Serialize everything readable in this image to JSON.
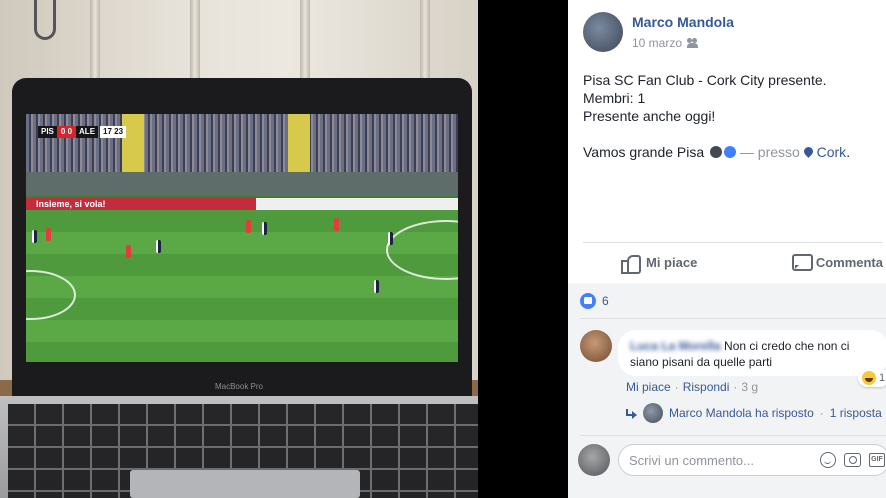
{
  "photo": {
    "laptop_brand": "MacBook Pro",
    "scoreboard": {
      "home": "PIS",
      "score": "0 0",
      "away": "ALE",
      "clock": "17 23"
    },
    "banner_text": "Insieme, si vola!"
  },
  "post": {
    "author": "Marco Mandola",
    "date": "10 marzo",
    "audience_icon": "friends-icon",
    "line1": "Pisa SC Fan Club - Cork City presente.",
    "line2": "Membri: 1",
    "line3": "Presente anche oggi!",
    "line4_text": "Vamos grande Pisa",
    "line4_presso": "— presso",
    "location": "Cork",
    "period": "."
  },
  "actions": {
    "like_label": "Mi piace",
    "comment_label": "Commenta"
  },
  "reactions": {
    "count": "6",
    "icon": "like-icon"
  },
  "comment": {
    "author": "Luca La Morella",
    "text": "Non ci credo che non ci siano pisani da quelle parti",
    "reaction_count": "1",
    "reaction_icon": "haha-icon",
    "like_label": "Mi piace",
    "reply_label": "Rispondi",
    "time": "3 g",
    "separator": "·"
  },
  "replies": {
    "text": "Marco Mandola ha risposto",
    "separator": "·",
    "count_text": "1 risposta"
  },
  "composer": {
    "placeholder": "Scrivi un commento...",
    "gif_label": "GIF"
  }
}
